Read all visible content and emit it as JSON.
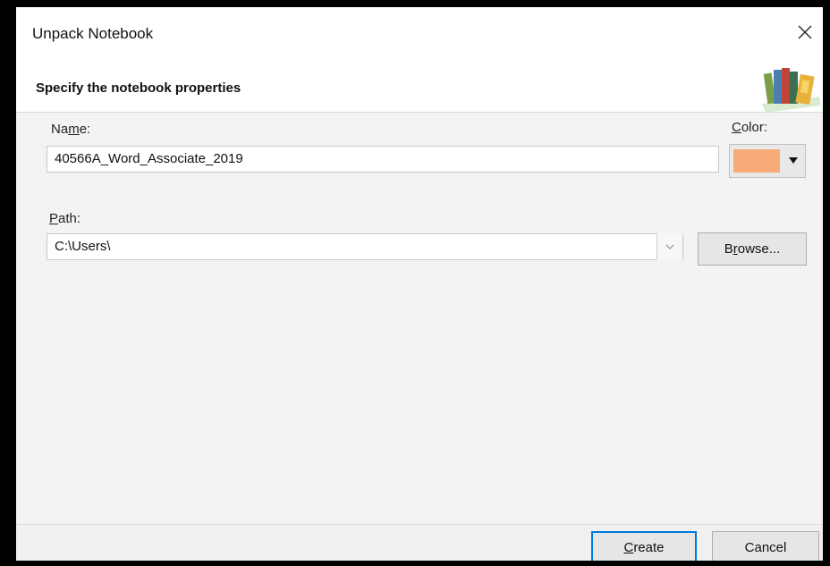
{
  "window": {
    "title": "Unpack Notebook"
  },
  "header": {
    "text": "Specify the notebook properties",
    "art_icon": "stack-of-books-icon"
  },
  "form": {
    "name": {
      "label_pre": "Na",
      "label_accel": "m",
      "label_post": "e:",
      "value": "40566A_Word_Associate_2019"
    },
    "color": {
      "label_accel": "C",
      "label_post": "olor:",
      "selected_color": "#f7ab76"
    },
    "path": {
      "label_accel": "P",
      "label_post": "ath:",
      "value": "C:\\Users\\"
    },
    "browse": {
      "pre": "B",
      "accel": "r",
      "post": "owse..."
    }
  },
  "footer": {
    "create": {
      "accel": "C",
      "post": "reate"
    },
    "cancel": "Cancel"
  },
  "colors": {
    "primary_button_border": "#0078d7",
    "body_background": "#f3f3f3"
  }
}
